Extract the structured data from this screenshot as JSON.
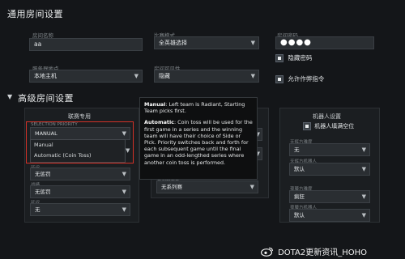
{
  "general": {
    "title": "通用房间设置",
    "room_name_label": "房间名称",
    "room_name_value": "aa",
    "game_mode_label": "比赛模式",
    "game_mode_value": "全英雄选择",
    "password_label": "房间密码",
    "password_value": "●●●●",
    "hide_password_label": "隐藏密码",
    "server_location_label": "服务器地点",
    "server_location_value": "本地主机",
    "visibility_label": "房间可见性",
    "visibility_value": "隐藏",
    "allow_cheats_label": "允许作弊指令"
  },
  "advanced": {
    "title": "高级房间设置",
    "left_header": "联赛专用",
    "selection_priority_label": "SELECTION PRIORITY",
    "selection_priority_value": "MANUAL",
    "menu_options": [
      "Manual",
      "Automatic (Coin Toss)"
    ],
    "left_dd_a": "无惩罚",
    "left_dd_a_label": "延迟",
    "left_dd_b": "无惩罚",
    "left_dd_b_label": "战绩",
    "left_dd_c": "无",
    "left_dd_c_label": "延迟",
    "mid_label": "系列赛类型",
    "mid_value": "无系列赛",
    "right_header": "机器人设置",
    "fill_bots_label": "机器人填满空位",
    "bot_rows": [
      {
        "label": "天辉方难度",
        "value": "无"
      },
      {
        "label": "天辉方机器人",
        "value": "默认"
      },
      {
        "label": "夜魇方难度",
        "value": "疯狂"
      },
      {
        "label": "夜魇方机器人",
        "value": "默认"
      }
    ]
  },
  "tooltip": {
    "manual_title": "Manual",
    "manual_text": ": Left team is Radiant, Starting Team picks first.",
    "auto_title": "Automatic",
    "auto_text": ": Coin toss will be used for the first game in a series and the winning team will have their choice of Side or Pick. Priority switches back and forth for each subsequent game until the final game in an odd-lengthed series where another coin toss is performed."
  },
  "watermark": "DOTA2更新资讯_HOHO",
  "icons": {
    "collapse": "triangle-down-icon",
    "chevron": "chevron-down-icon",
    "weibo": "weibo-logo-icon"
  },
  "colors": {
    "background": "#141619",
    "highlight_box": "#d33127"
  }
}
